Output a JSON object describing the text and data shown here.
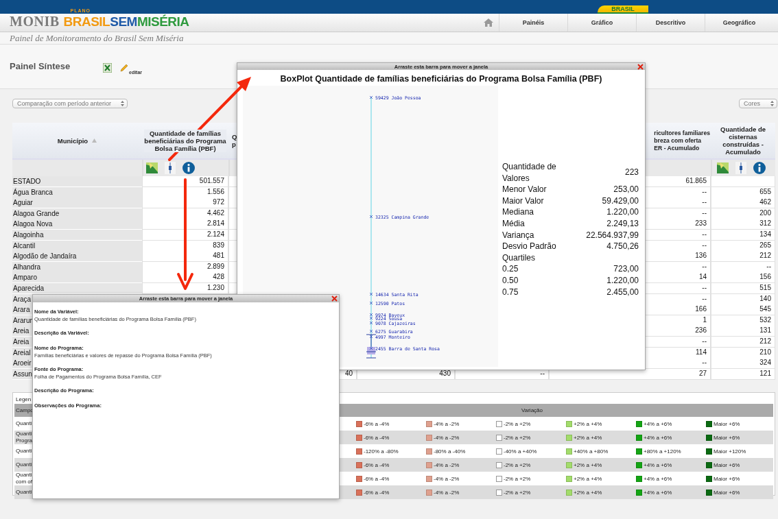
{
  "header": {
    "flag_label": "BRASIL",
    "logo": {
      "monib": "MONIB",
      "plano": "PLANO",
      "brasil": "BRASIL",
      "sem": "SEM",
      "miseria": "MISÉRIA"
    },
    "nav": [
      {
        "label": "Painéis"
      },
      {
        "label": "Gráfico"
      },
      {
        "label": "Descritivo"
      },
      {
        "label": "Geográfico"
      }
    ],
    "subtitle": "Painel de Monitoramento do Brasil Sem Miséria"
  },
  "panel": {
    "title": "Painel Síntese",
    "edit_label": "editar",
    "period_select": "Comparação com período anterior",
    "colors_select": "Cores"
  },
  "table": {
    "columns": {
      "municipio": {
        "lines": [
          "Município"
        ],
        "sorted": true
      },
      "pbf": {
        "lines": [
          "Quantidade de famílias",
          "beneficiárias do Programa",
          "Bolsa Família (PBF)"
        ],
        "tools": true
      },
      "column_3": {
        "lines": [
          "Q",
          "p"
        ]
      },
      "agricultores": {
        "lines": [
          "ricultores familiares",
          "breza com oferta",
          "ER - Acumulado"
        ]
      },
      "cisternas": {
        "lines": [
          "Quantidade de",
          "cisternas",
          "construídas -",
          "Acumulado"
        ],
        "tools": true
      }
    },
    "rows": [
      {
        "municipio": "ESTADO",
        "pbf": "501.557",
        "agricultores": "61.865"
      },
      {
        "municipio": "Água Branca",
        "pbf": "1.556",
        "agricultores": "--",
        "cisternas": "655"
      },
      {
        "municipio": "Aguiar",
        "pbf": "972",
        "agricultores": "--",
        "cisternas": "462"
      },
      {
        "municipio": "Alagoa Grande",
        "pbf": "4.462",
        "agricultores": "--",
        "cisternas": "200"
      },
      {
        "municipio": "Alagoa Nova",
        "pbf": "2.814",
        "agricultores": "233",
        "cisternas": "312"
      },
      {
        "municipio": "Alagoinha",
        "pbf": "2.124",
        "agricultores": "--",
        "cisternas": "134"
      },
      {
        "municipio": "Alcantil",
        "pbf": "839",
        "agricultores": "--",
        "cisternas": "265"
      },
      {
        "municipio": "Algodão de Jandaíra",
        "pbf": "481",
        "agricultores": "136",
        "cisternas": "212"
      },
      {
        "municipio": "Alhandra",
        "pbf": "2.899",
        "agricultores": "--",
        "cisternas": "--"
      },
      {
        "municipio": "Amparo",
        "pbf": "428",
        "agricultores": "14",
        "cisternas": "156"
      },
      {
        "municipio": "Aparecida",
        "pbf": "1.230",
        "agricultores": "--",
        "cisternas": "515"
      },
      {
        "municipio": "Araça",
        "agricultores": "--",
        "cisternas": "140"
      },
      {
        "municipio": "Arara",
        "agricultores": "166",
        "cisternas": "545"
      },
      {
        "municipio": "Ararun",
        "agricultores": "1",
        "cisternas": "532"
      },
      {
        "municipio": "Areia",
        "agricultores": "236",
        "cisternas": "131"
      },
      {
        "municipio": "Areia",
        "agricultores": "--",
        "cisternas": "212"
      },
      {
        "municipio": "Areial",
        "agricultores": "114",
        "cisternas": "210"
      },
      {
        "municipio": "Aroeir",
        "agricultores": "--",
        "cisternas": "324"
      },
      {
        "municipio": "Assun",
        "column_3": "40",
        "column_4": "430",
        "column_5": "--",
        "agricultores": "27",
        "cisternas": "121"
      }
    ]
  },
  "legend": {
    "title": "Legen",
    "field_header": "Campo",
    "variation_header": "Variação",
    "rows": [
      {
        "field": [
          "Quanti"
        ],
        "items": [
          {
            "label": "-6% a -4%",
            "color": "#d9715a"
          },
          {
            "label": "-4% a -2%",
            "color": "#dfa08e"
          },
          {
            "label": "-2% a +2%",
            "color": "#ffffff"
          },
          {
            "label": "+2% a +4%",
            "color": "#a3dc6b"
          },
          {
            "label": "+4% a +6%",
            "color": "#14a514"
          },
          {
            "label": "Maior +6%",
            "color": "#0b6a12"
          }
        ]
      },
      {
        "field": [
          "Quanti",
          "Progra"
        ],
        "items": [
          {
            "label": "-6% a -4%",
            "color": "#d9715a"
          },
          {
            "label": "-4% a -2%",
            "color": "#dfa08e"
          },
          {
            "label": "-2% a +2%",
            "color": "#ffffff"
          },
          {
            "label": "+2% a +4%",
            "color": "#a3dc6b"
          },
          {
            "label": "+4% a +6%",
            "color": "#14a514"
          },
          {
            "label": "Maior +6%",
            "color": "#0b6a12"
          }
        ]
      },
      {
        "field": [
          "Quanti"
        ],
        "items": [
          {
            "label": "-120% a -80%",
            "color": "#d9715a"
          },
          {
            "label": "-80% a -40%",
            "color": "#dfa08e"
          },
          {
            "label": "-40% a +40%",
            "color": "#ffffff"
          },
          {
            "label": "+40% a +80%",
            "color": "#a3dc6b"
          },
          {
            "label": "+80% a +120%",
            "color": "#14a514"
          },
          {
            "label": "Maior +120%",
            "color": "#0b6a12"
          }
        ]
      },
      {
        "field": [
          "Quanti"
        ],
        "items": [
          {
            "label": "-6% a -4%",
            "color": "#d9715a"
          },
          {
            "label": "-4% a -2%",
            "color": "#dfa08e"
          },
          {
            "label": "-2% a +2%",
            "color": "#ffffff"
          },
          {
            "label": "+2% a +4%",
            "color": "#a3dc6b"
          },
          {
            "label": "+4% a +6%",
            "color": "#14a514"
          },
          {
            "label": "Maior +6%",
            "color": "#0b6a12"
          }
        ]
      },
      {
        "field": [
          "Quanti",
          "com of"
        ],
        "items": [
          {
            "label": "-6% a -4%",
            "color": "#d9715a"
          },
          {
            "label": "-4% a -2%",
            "color": "#dfa08e"
          },
          {
            "label": "-2% a +2%",
            "color": "#ffffff"
          },
          {
            "label": "+2% a +4%",
            "color": "#a3dc6b"
          },
          {
            "label": "+4% a +6%",
            "color": "#14a514"
          },
          {
            "label": "Maior +6%",
            "color": "#0b6a12"
          }
        ]
      },
      {
        "field": [
          "Quanti"
        ],
        "items": [
          {
            "label": "-6% a -4%",
            "color": "#d9715a"
          },
          {
            "label": "-4% a -2%",
            "color": "#dfa08e"
          },
          {
            "label": "-2% a +2%",
            "color": "#ffffff"
          },
          {
            "label": "+2% a +4%",
            "color": "#a3dc6b"
          },
          {
            "label": "+4% a +6%",
            "color": "#14a514"
          },
          {
            "label": "Maior +6%",
            "color": "#0b6a12"
          }
        ]
      }
    ]
  },
  "boxplot_window": {
    "drag_bar": "Arraste esta barra para mover a janela",
    "title": "BoxPlot Quantidade de famílias beneficiárias do Programa Bolsa Família (PBF)",
    "point_labels": [
      "59429 João Pessoa",
      "32325 Campina Grande",
      "14634 Santa Rita",
      "12590 Patos",
      "9974 Bayeux",
      "9224 Sousa",
      "9078 Cajazeiras",
      "6275 Guarabira",
      "4997 Monteiro",
      "2455 Barra de Santa Rosa"
    ],
    "stats": [
      {
        "label": "Quantidade de Valores",
        "value": "223"
      },
      {
        "label": "Menor Valor",
        "value": "253,00"
      },
      {
        "label": "Maior Valor",
        "value": "59.429,00"
      },
      {
        "label": "Mediana",
        "value": "1.220,00"
      },
      {
        "label": "Média",
        "value": "2.249,13"
      },
      {
        "label": "Variança",
        "value": "22.564.937,99"
      },
      {
        "label": "Desvio Padrão",
        "value": "4.750,26"
      },
      {
        "label": "Quartiles"
      },
      {
        "label": "0.25",
        "value": "723,00"
      },
      {
        "label": "0.50",
        "value": "1.220,00"
      },
      {
        "label": "0.75",
        "value": "2.455,00"
      }
    ]
  },
  "info_window": {
    "drag_bar": "Arraste esta barra para mover a janela",
    "fields": [
      {
        "label": "Nome da Variável:",
        "value": "Quantidade de famílias beneficiárias do Programa Bolsa Família (PBF)"
      },
      {
        "label": "Descrição da Variável:"
      },
      {
        "label": "Nome do Programa:",
        "value": "Famílias beneficiárias e valores de repasse do Programa Bolsa Família (PBF)"
      },
      {
        "label": "Fonte do Programa:",
        "value": "Folha de Pagamentos do Programa Bolsa Família, CEF"
      },
      {
        "label": "Descrição do Programa:"
      },
      {
        "label": "Observações do Programa:"
      }
    ]
  }
}
